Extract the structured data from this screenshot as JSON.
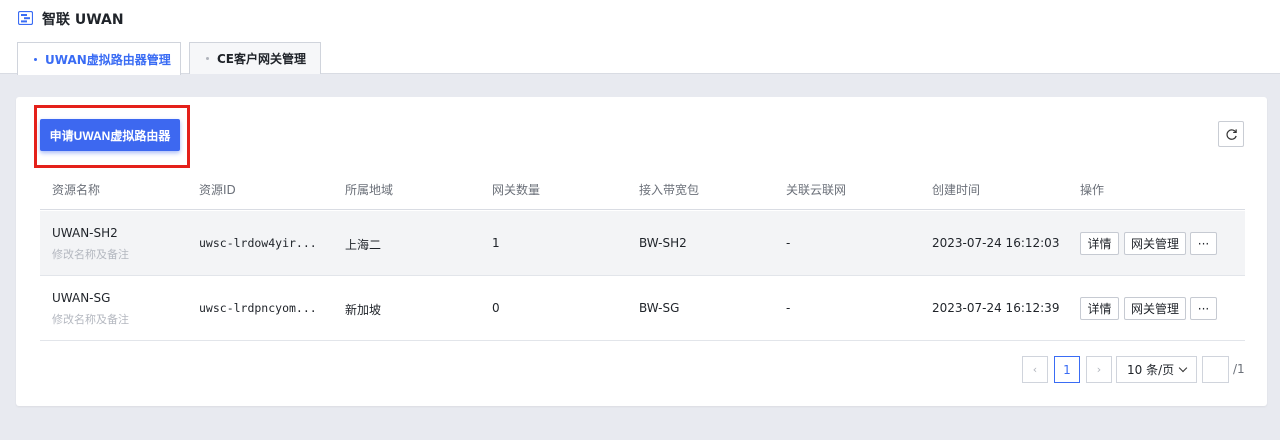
{
  "app": {
    "title": "智联 UWAN",
    "logo_icon": "uwan-logo-icon"
  },
  "tabs": [
    {
      "label": "UWAN虚拟路由器管理",
      "active": true
    },
    {
      "label": "CE客户网关管理",
      "active": false
    }
  ],
  "toolbar": {
    "apply_label": "申请UWAN虚拟路由器",
    "refresh_icon": "refresh-icon"
  },
  "table": {
    "columns": [
      "资源名称",
      "资源ID",
      "所属地域",
      "网关数量",
      "接入带宽包",
      "关联云联网",
      "创建时间",
      "操作"
    ],
    "rows": [
      {
        "name": "UWAN-SH2",
        "remark": "修改名称及备注",
        "id": "uwsc-lrdow4yir...",
        "region": "上海二",
        "gateways": "1",
        "bandwidth": "BW-SH2",
        "ccn": "-",
        "created": "2023-07-24 16:12:03"
      },
      {
        "name": "UWAN-SG",
        "remark": "修改名称及备注",
        "id": "uwsc-lrdpncyom...",
        "region": "新加坡",
        "gateways": "0",
        "bandwidth": "BW-SG",
        "ccn": "-",
        "created": "2023-07-24 16:12:39"
      }
    ],
    "actions": {
      "detail": "详情",
      "gateway_manage": "网关管理",
      "more": "···"
    }
  },
  "pagination": {
    "prev": "‹",
    "current_page": "1",
    "next": "›",
    "page_size": "10 条/页",
    "total_pages": "/1"
  },
  "colors": {
    "accent": "#3d68f0",
    "highlight_box": "#e4201a"
  }
}
